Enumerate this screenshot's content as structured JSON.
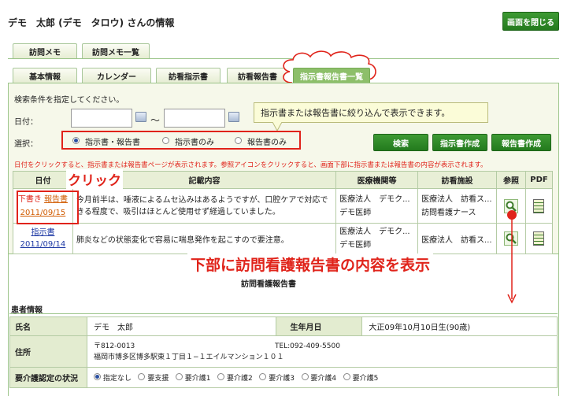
{
  "page_title": "デモ　太郎 (デモ　タロウ) さんの情報",
  "close_button": "画面を閉じる",
  "top_tabs": [
    "訪問メモ",
    "訪問メモ一覧"
  ],
  "sub_tabs": [
    "基本情報",
    "カレンダー",
    "訪看指示書",
    "訪看報告書",
    "指示書報告書一覧"
  ],
  "search": {
    "hint": "検索条件を指定してください。",
    "date_label": "日付：",
    "tilde": "〜",
    "select_label": "選択：",
    "options": [
      "指示書・報告書",
      "指示書のみ",
      "報告書のみ"
    ],
    "selected_option": "指示書・報告書"
  },
  "tooltip": "指示書または報告書に絞り込んで表示できます。",
  "buttons": {
    "search": "検索",
    "create_instruction": "指示書作成",
    "create_report": "報告書作成"
  },
  "note": "日付をクリックすると、指示書または報告書ページが表示されます。参照アイコンをクリックすると、画面下部に指示書または報告書の内容が表示されます。",
  "click_callout": "クリック",
  "table": {
    "headers": [
      "日付",
      "記載内容",
      "医療機関等",
      "訪看施設",
      "参照",
      "PDF"
    ],
    "rows": [
      {
        "status": "下書き",
        "type": "報告書",
        "date": "2011/09/15",
        "content": "今月前半は、唾液によるムセ込みはあるようですが、口腔ケアで対応できる程度で、吸引はほとんど使用せず経過していました。",
        "institution1": "医療法人　デモク...",
        "institution2": "デモ医師",
        "facility1": "医療法人　訪看ス...",
        "facility2": "訪問看護ナース"
      },
      {
        "status": "",
        "type": "指示書",
        "date": "2011/09/14",
        "content": "肺炎などの状態変化で容易に喘息発作を起こすので要注意。",
        "institution1": "医療法人　デモク...",
        "institution2": "デモ医師",
        "facility1": "医療法人　訪看ス...",
        "facility2": ""
      }
    ]
  },
  "annotation": "下部に訪問看護報告書の内容を表示",
  "report": {
    "title": "訪問看護報告書",
    "section": "患者情報",
    "name_label": "氏名",
    "name_value": "デモ　太郎",
    "dob_label": "生年月日",
    "dob_value": "大正09年10月10日生(90歳)",
    "address_label": "住所",
    "postal": "〒812-0013",
    "tel": "TEL:092-409-5500",
    "address": "福岡市博多区博多駅東１丁目１−１エイルマンション１０１",
    "care_label": "要介護認定の状況",
    "care_options": [
      "指定なし",
      "要支援",
      "要介護1",
      "要介護2",
      "要介護3",
      "要介護4",
      "要介護5"
    ],
    "care_selected": "指定なし"
  },
  "colors": {
    "accent": "#2e8b28",
    "annotation_red": "#e0231a",
    "link_blue": "#1f3aa5"
  }
}
